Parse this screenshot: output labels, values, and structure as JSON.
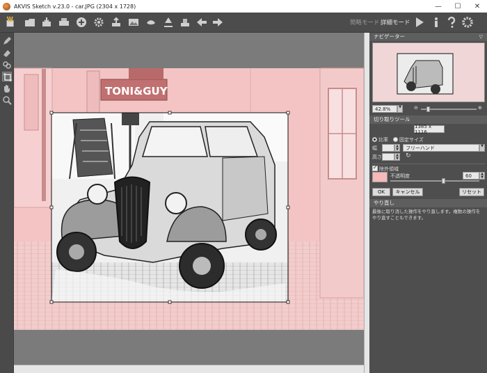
{
  "window": {
    "title": "AKVIS Sketch v.23.0 - car.JPG (2304 x 1728)",
    "controls": [
      "—",
      "☐",
      "✕"
    ]
  },
  "toolbar": {
    "icons": [
      "app-logo-icon",
      "open-icon",
      "save-icon",
      "print-icon",
      "share-icon",
      "settings-gear-icon",
      "upload-icon",
      "photo-icon",
      "hand-icon",
      "tool-arrow-icon",
      "backup-icon",
      "undo-icon",
      "redo-icon"
    ],
    "modes": {
      "simple": "簡略モード",
      "advanced": "詳細モード"
    },
    "right_icons": [
      "run-icon",
      "info-icon",
      "help-icon",
      "preferences-gear-icon"
    ]
  },
  "left_tools": [
    "pencil-icon",
    "eraser-icon",
    "chain-icon",
    "crop-icon",
    "hand-tool-icon",
    "zoom-icon"
  ],
  "canvas": {
    "sign_text": "TONI&GUY",
    "exclusion_color": "#f2b8b8"
  },
  "navigator": {
    "title": "ナビゲーター",
    "zoom": "42.8%",
    "zoom_minus": "⊖",
    "zoom_plus": "⊕"
  },
  "crop": {
    "title": "切り取りツール",
    "size": "1385 x 1116",
    "ratio_label": "比率",
    "fixed_label": "固定サイズ",
    "width_label": "幅",
    "height_label": "高さ",
    "preset": "フリーハンド",
    "exclude_label": "除外領域",
    "opacity_label": "不透明度",
    "opacity_value": "60",
    "exclude_color": "#f6b8b8",
    "ok": "OK",
    "cancel": "キャンセル",
    "reset": "リセット"
  },
  "undo": {
    "title": "やり直し",
    "text": "最後に取り消した操作をやり直します。複数の操作をやり直すこともできます。"
  }
}
